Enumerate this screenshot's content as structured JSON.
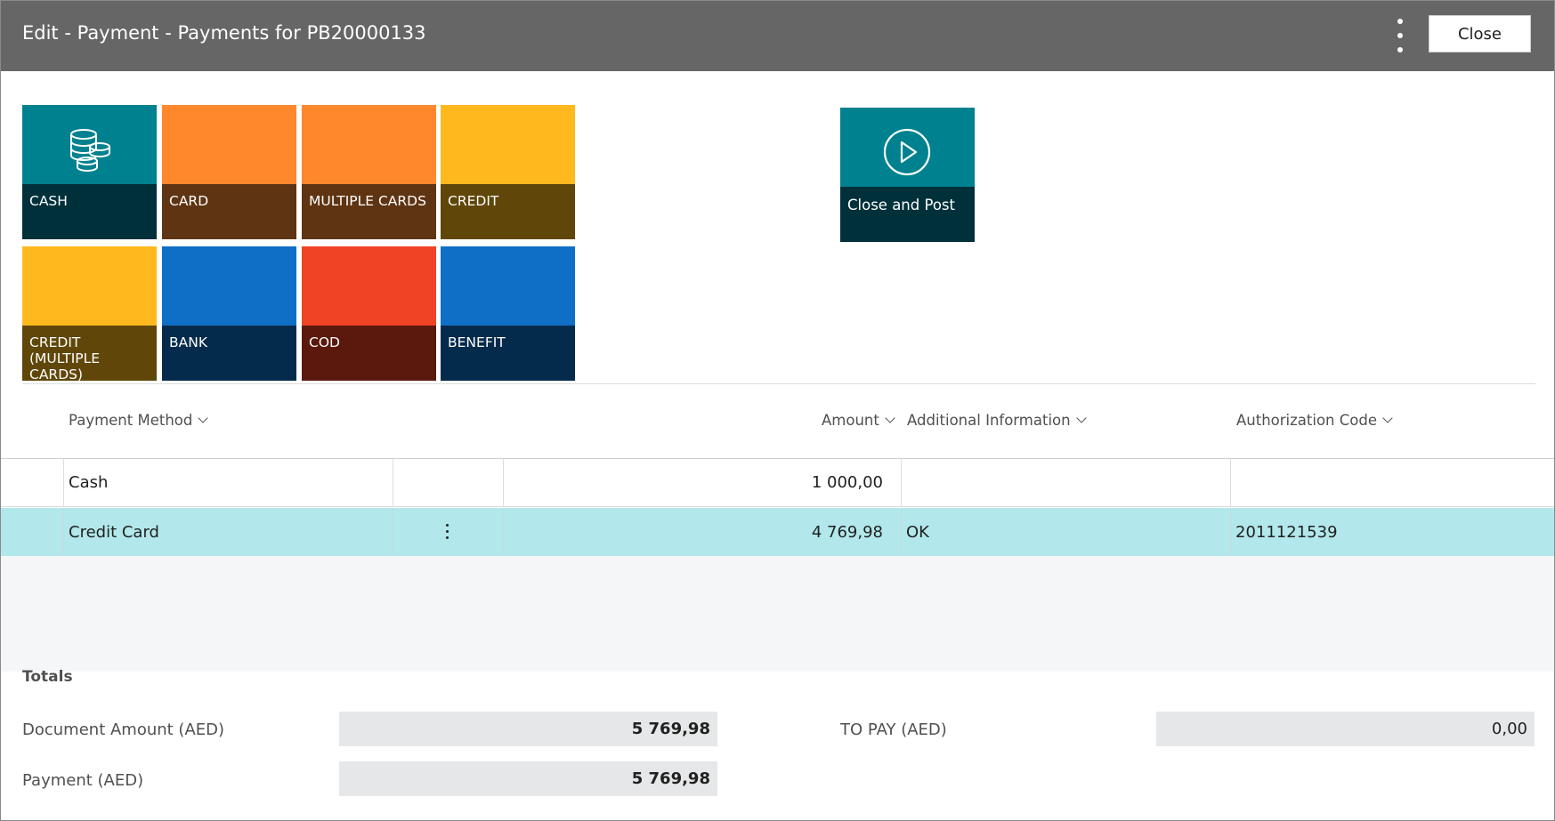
{
  "header": {
    "title": "Edit - Payment - Payments for PB20000133",
    "close_label": "Close"
  },
  "tiles": [
    {
      "label": "CASH",
      "top_color": "#00818f",
      "bottom_color": "#00303a",
      "icon": "coins-icon"
    },
    {
      "label": "CARD",
      "top_color": "#ff872c",
      "bottom_color": "#5f3412"
    },
    {
      "label": "MULTIPLE CARDS",
      "top_color": "#ff872c",
      "bottom_color": "#5f3412"
    },
    {
      "label": "CREDIT",
      "top_color": "#ffb91f",
      "bottom_color": "#604709"
    },
    {
      "label": "CREDIT (MULTIPLE CARDS)",
      "top_color": "#ffb91f",
      "bottom_color": "#604709"
    },
    {
      "label": "BANK",
      "top_color": "#0f6fc6",
      "bottom_color": "#042b4b"
    },
    {
      "label": "COD",
      "top_color": "#f04224",
      "bottom_color": "#5b180d"
    },
    {
      "label": "BENEFIT",
      "top_color": "#0f6fc6",
      "bottom_color": "#042b4b"
    }
  ],
  "close_and_post": {
    "label": "Close and Post",
    "top_color": "#00818f",
    "bottom_color": "#00303a",
    "icon": "play-circle-icon"
  },
  "table": {
    "columns": {
      "payment_method": "Payment Method",
      "amount": "Amount",
      "additional_info": "Additional Information",
      "auth_code": "Authorization Code"
    },
    "rows": [
      {
        "payment_method": "Cash",
        "amount": "1 000,00",
        "additional_info": "",
        "auth_code": ""
      },
      {
        "payment_method": "Credit Card",
        "amount": "4 769,98",
        "additional_info": "OK",
        "auth_code": "2011121539"
      }
    ]
  },
  "totals": {
    "title": "Totals",
    "document_amount_label": "Document Amount (AED)",
    "document_amount_value": "5 769,98",
    "payment_label": "Payment (AED)",
    "payment_value": "5 769,98",
    "to_pay_label": "TO PAY (AED)",
    "to_pay_value": "0,00"
  },
  "colors": {
    "header_bg": "#666666",
    "selected_row": "#b2e8eb"
  }
}
